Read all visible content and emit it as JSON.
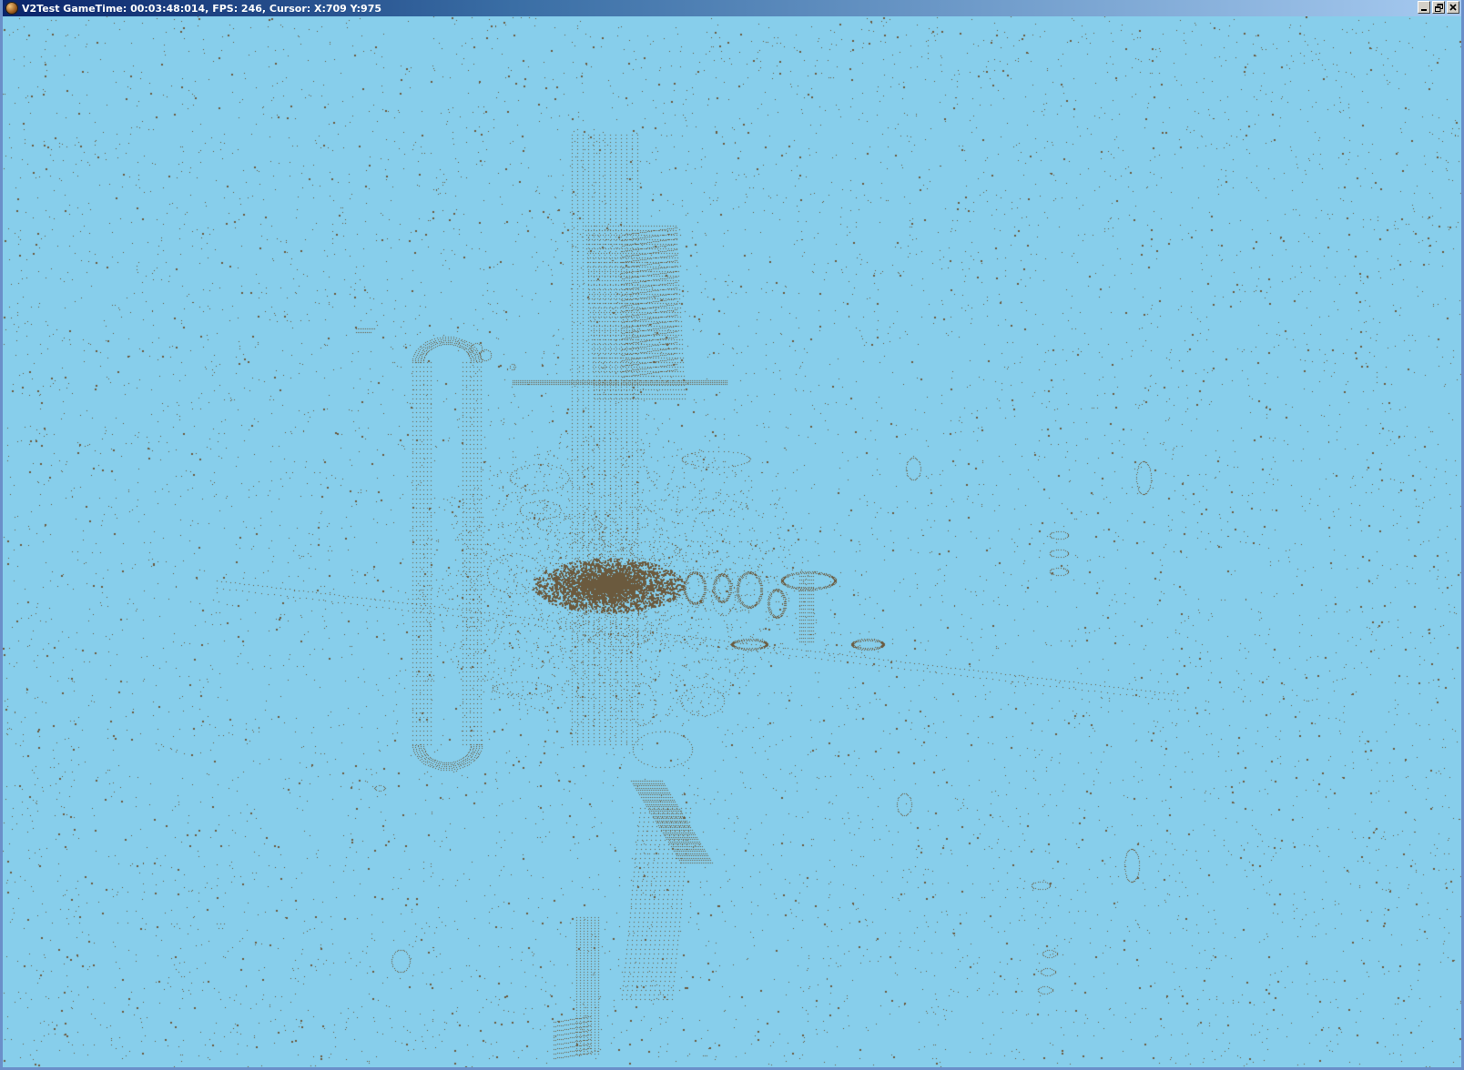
{
  "window": {
    "title": "V2Test GameTime: 00:03:48:014, FPS: 246, Cursor: X:709 Y:975",
    "controls": {
      "minimize": "minimize",
      "restore": "restore",
      "close": "close"
    }
  },
  "viewport": {
    "background_color": "#87ceeb",
    "point_color": "#6b5a3e",
    "render_style": "point-cloud wireframe"
  },
  "icons": {
    "app": "game-app-icon",
    "minimize": "minimize-icon",
    "restore": "restore-icon",
    "close": "close-icon"
  }
}
